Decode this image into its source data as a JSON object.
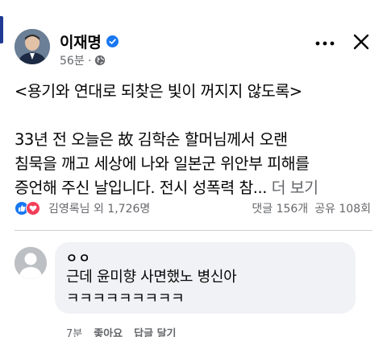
{
  "post": {
    "author": "이재명",
    "time": "56분 ·",
    "title_line": "<용기와 연대로 되찾은 빛이 꺼지지 않도록>",
    "body_lines": [
      "33년 전 오늘은 故 김학순 할머님께서 오랜",
      "침묵을 깨고 세상에 나와 일본군 위안부 피해를",
      "증언해 주신 날입니다. 전시 성폭력 참..."
    ],
    "see_more": "더 보기"
  },
  "stats": {
    "reaction_summary": "김영록님 외 1,726명",
    "comments": "댓글 156개",
    "shares": "공유 108회"
  },
  "comment": {
    "author": "ㅇㅇ",
    "lines": [
      "근데 윤미향 사면했노 병신아",
      "ㅋㅋㅋㅋㅋㅋㅋㅋㅋ"
    ],
    "actions": {
      "time": "7분",
      "like": "좋아요",
      "reply": "답글 달기"
    }
  },
  "colors": {
    "accent": "#1877f2",
    "love": "#f33e58",
    "muted_text": "#65676b",
    "bubble": "#f0f2f5"
  },
  "icons": {
    "verified": "verified-badge-icon",
    "privacy": "globe-icon",
    "more": "more-options-icon",
    "close": "close-icon",
    "like": "like-reaction-icon",
    "love": "love-reaction-icon"
  }
}
